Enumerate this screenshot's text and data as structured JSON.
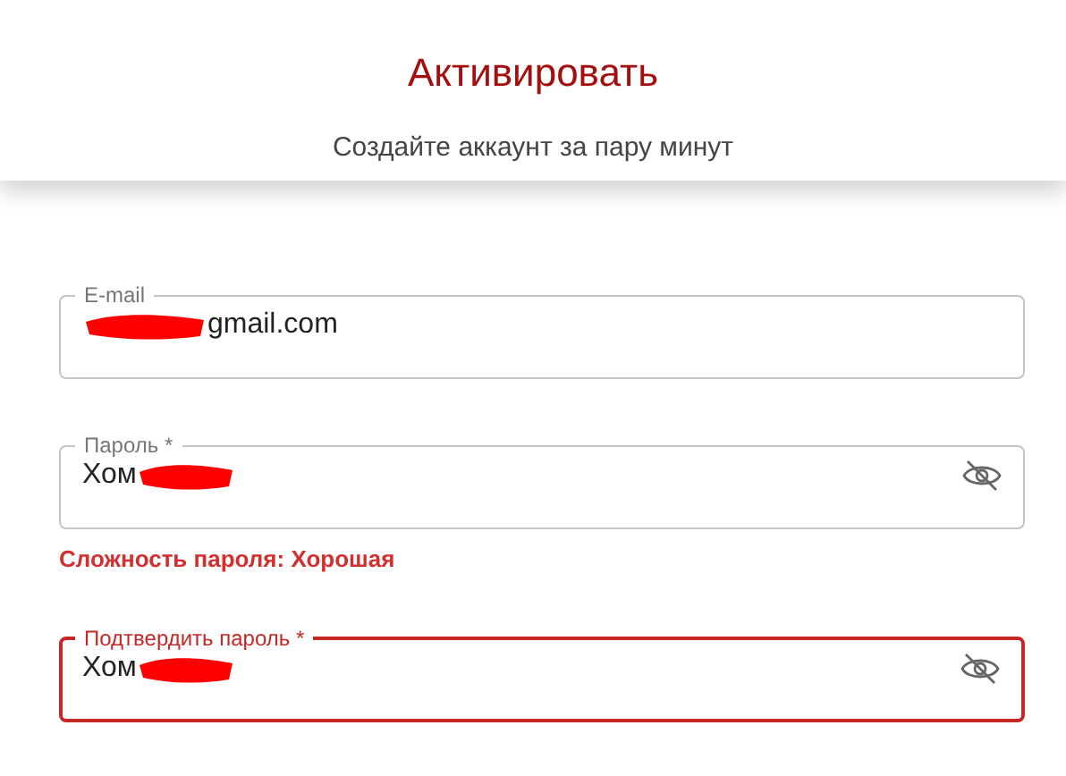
{
  "header": {
    "title": "Активировать",
    "subtitle": "Создайте аккаунт за пару минут"
  },
  "fields": [
    {
      "label": "E-mail",
      "value": "gmail.com",
      "redacted": true,
      "focused": false,
      "visibility_toggle": false
    },
    {
      "label": "Пароль *",
      "value": "Хом",
      "redacted": true,
      "focused": false,
      "visibility_toggle": true,
      "hint": "Сложность пароля: Хорошая"
    },
    {
      "label": "Подтвердить пароль *",
      "value": "Хом",
      "redacted": true,
      "focused": true,
      "visibility_toggle": true
    }
  ]
}
